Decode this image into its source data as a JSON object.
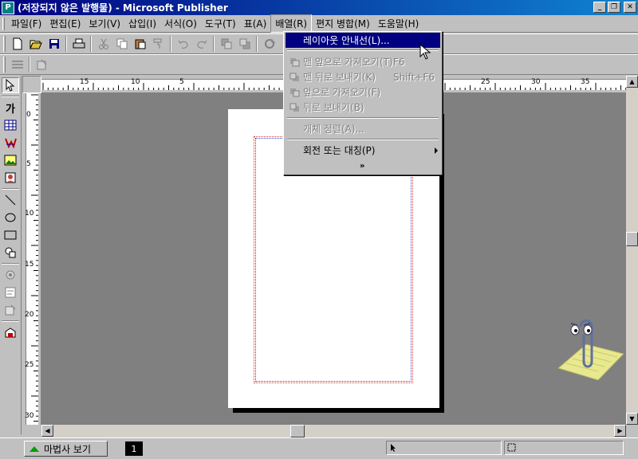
{
  "window": {
    "app_icon": "P",
    "title": "(저장되지 않은 발행물) - Microsoft Publisher",
    "minimize": "_",
    "restore": "❐",
    "close": "✕"
  },
  "menubar": {
    "items": [
      "파일(F)",
      "편집(E)",
      "보기(V)",
      "삽입(I)",
      "서식(O)",
      "도구(T)",
      "표(A)",
      "배열(R)",
      "편지 병합(M)",
      "도움말(H)"
    ]
  },
  "toolbar": {
    "icons": [
      "new-icon",
      "open-icon",
      "save-icon",
      "print-icon",
      "cut-icon",
      "copy-icon",
      "paste-icon",
      "format-painter-icon",
      "undo-icon",
      "redo-icon",
      "bring-front-icon",
      "send-back-icon",
      "rotate-icon"
    ]
  },
  "toolbox": {
    "text_tool_label": "가"
  },
  "ruler": {
    "h_labels": [
      "15",
      "10",
      "5",
      "25",
      "30",
      "35"
    ],
    "v_labels": [
      "0",
      "5",
      "10",
      "15",
      "20",
      "25",
      "30"
    ]
  },
  "arrange_menu": {
    "items": [
      {
        "label": "레이아웃 안내선(L)...",
        "shortcut": "",
        "state": "highlighted"
      },
      {
        "label": "맨 앞으로 가져오기(T)",
        "shortcut": "F6",
        "state": "disabled"
      },
      {
        "label": "맨 뒤로 보내기(K)",
        "shortcut": "Shift+F6",
        "state": "disabled"
      },
      {
        "label": "앞으로 가져오기(F)",
        "shortcut": "",
        "state": "disabled"
      },
      {
        "label": "뒤로 보내기(B)",
        "shortcut": "",
        "state": "disabled"
      },
      {
        "label": "개체 정렬(A)...",
        "shortcut": "",
        "state": "disabled"
      },
      {
        "label": "회전 또는 대칭(P)",
        "shortcut": "",
        "state": "enabled"
      }
    ],
    "expand_glyph": "»"
  },
  "statusbar": {
    "wizard_label": "마법사 보기",
    "page_number": "1"
  },
  "colors": {
    "title_bar": "#000080",
    "menu_highlight": "#000080",
    "workspace": "#808080",
    "guide_red": "#d04040",
    "guide_blue": "#3040d0"
  }
}
